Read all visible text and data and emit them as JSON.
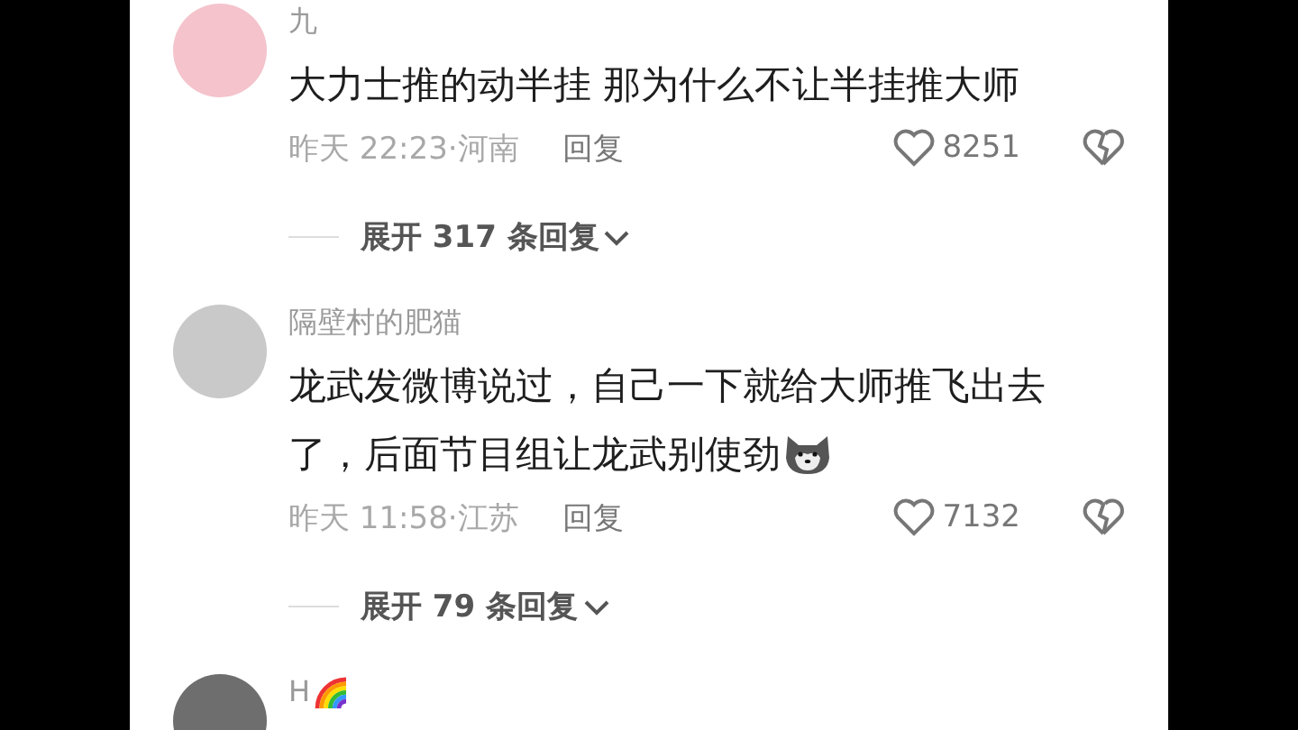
{
  "comments": [
    {
      "username": "九",
      "name_emoji": false,
      "avatar": {
        "color": "#f4c3cc"
      },
      "text": "大力士推的动半挂 那为什么不让半挂推大师",
      "text_emoji": false,
      "time_location": "昨天 22:23·河南",
      "reply_label": "回复",
      "like_count": "8251",
      "expand_label": "展开 317 条回复"
    },
    {
      "username": "隔壁村的肥猫",
      "name_emoji": false,
      "avatar": {
        "color": "#c9c9c9"
      },
      "text": "龙武发微博说过，自己一下就给大师推飞出去了，后面节目组让龙武别使劲",
      "text_emoji": true,
      "time_location": "昨天 11:58·江苏",
      "reply_label": "回复",
      "like_count": "7132",
      "expand_label": "展开 79 条回复"
    },
    {
      "username": "H",
      "name_emoji": true,
      "avatar": {
        "color": "#6e6e6e"
      }
    }
  ]
}
